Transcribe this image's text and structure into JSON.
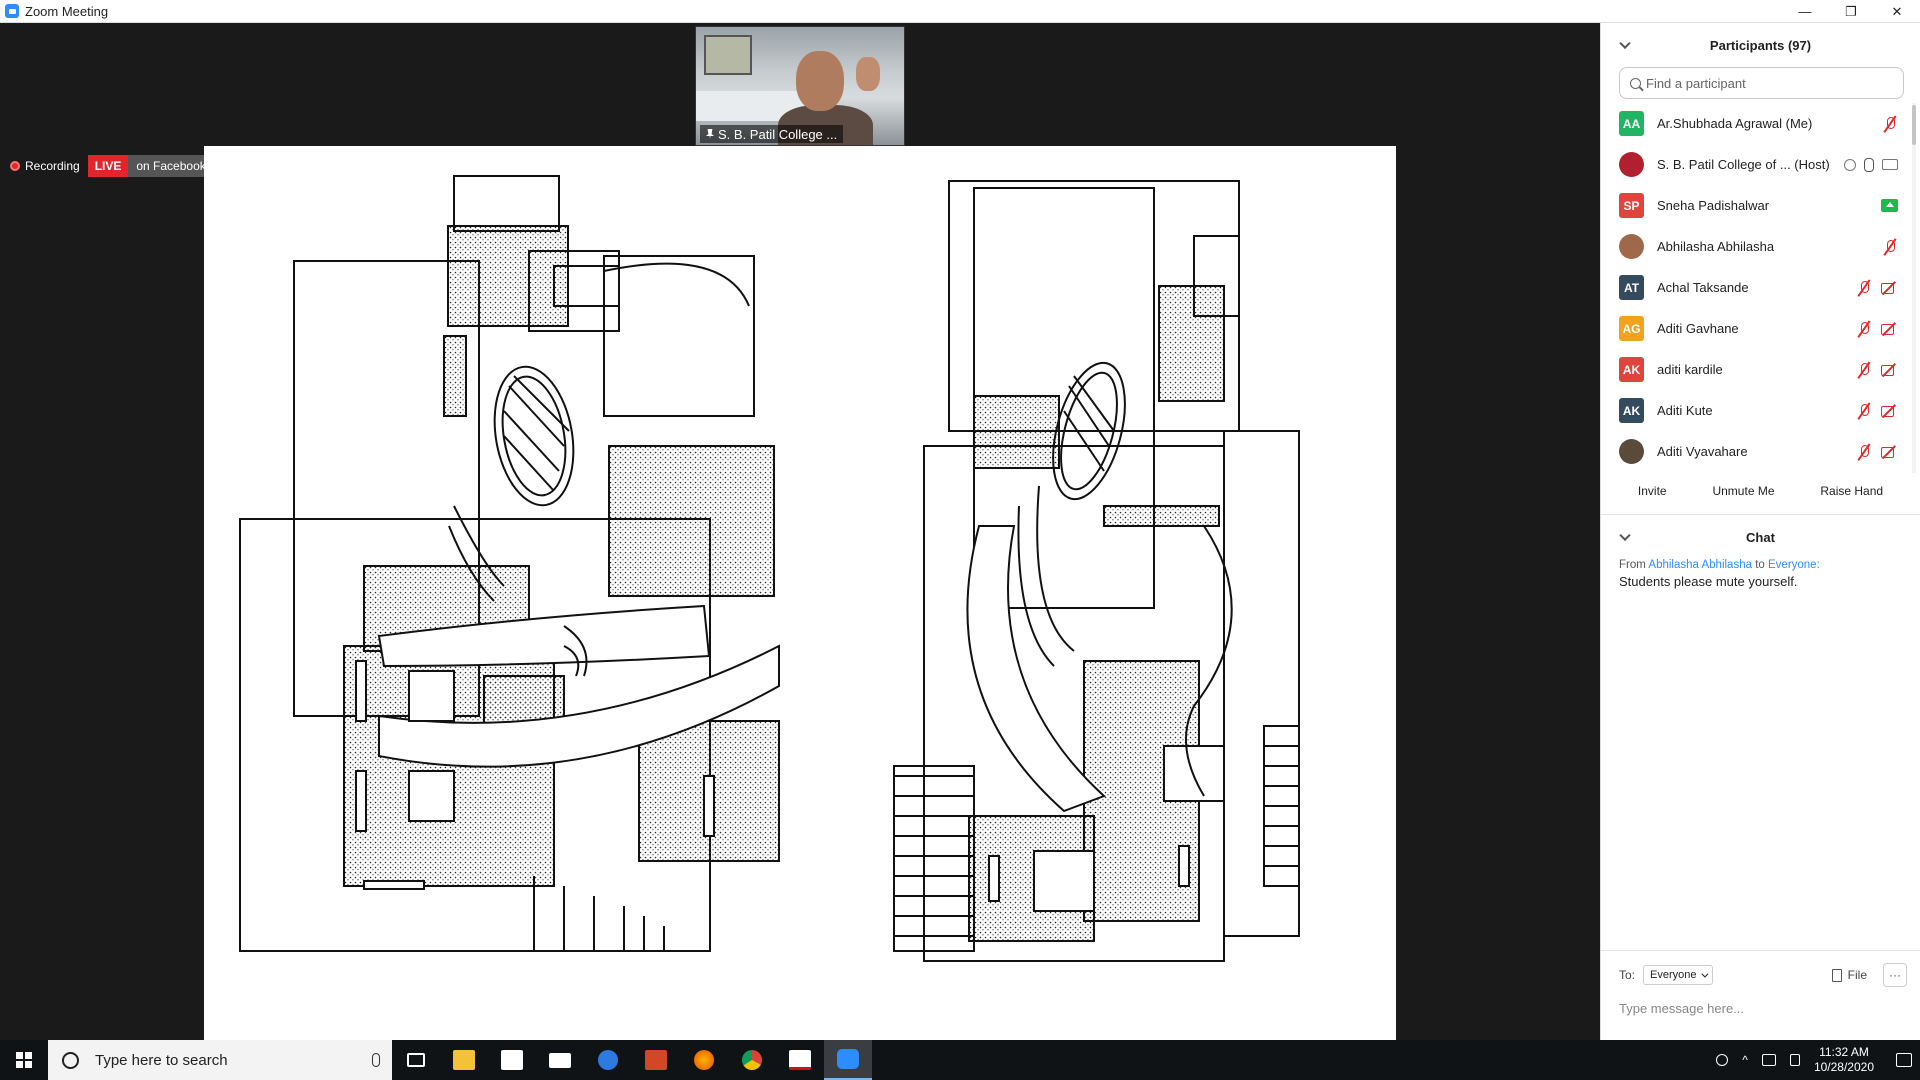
{
  "window": {
    "title": "Zoom Meeting",
    "minimize": "—",
    "restore": "❐",
    "close": "✕"
  },
  "video": {
    "speaker_name": "S. B. Patil College ..."
  },
  "recording": {
    "label": "Recording",
    "live": "LIVE",
    "platform": "on Facebook"
  },
  "participants": {
    "header": "Participants (97)",
    "search_placeholder": "Find a participant",
    "list": [
      {
        "initials": "AA",
        "color": "#1fb562",
        "name": "Ar.Shubhada Agrawal (Me)",
        "icons": [
          "mic-muted"
        ]
      },
      {
        "initials": "",
        "color": "#b02030",
        "name": "S. B. Patil College of ...  (Host)",
        "icons": [
          "rec",
          "mic-on",
          "cam-on"
        ]
      },
      {
        "initials": "SP",
        "color": "#e0453d",
        "name": "Sneha Padishalwar",
        "icons": [
          "share"
        ]
      },
      {
        "initials": "",
        "color": "#a0674b",
        "name": "Abhilasha Abhilasha",
        "icons": [
          "mic-muted"
        ]
      },
      {
        "initials": "AT",
        "color": "#344a5e",
        "name": "Achal Taksande",
        "icons": [
          "mic-muted",
          "cam-off"
        ]
      },
      {
        "initials": "AG",
        "color": "#f2a21d",
        "name": "Aditi  Gavhane",
        "icons": [
          "mic-muted",
          "cam-off"
        ]
      },
      {
        "initials": "AK",
        "color": "#e0453d",
        "name": "aditi kardile",
        "icons": [
          "mic-muted",
          "cam-off"
        ]
      },
      {
        "initials": "AK",
        "color": "#344a5e",
        "name": "Aditi Kute",
        "icons": [
          "mic-muted",
          "cam-off"
        ]
      },
      {
        "initials": "",
        "color": "#5a4a3a",
        "name": "Aditi Vyavahare",
        "icons": [
          "mic-muted",
          "cam-off"
        ]
      }
    ],
    "buttons": {
      "invite": "Invite",
      "unmute": "Unmute Me",
      "raise_hand": "Raise Hand"
    }
  },
  "chat": {
    "header": "Chat",
    "message": {
      "from_label": "From",
      "sender": "Abhilasha Abhilasha",
      "to_label": "to",
      "recipient": "Everyone:",
      "text": "Students please mute yourself."
    },
    "to_label": "To:",
    "to_value": "Everyone",
    "file_label": "File",
    "more": "···",
    "input_placeholder": "Type message here..."
  },
  "taskbar": {
    "search_placeholder": "Type here to search",
    "time": "11:32 AM",
    "date": "10/28/2020"
  }
}
